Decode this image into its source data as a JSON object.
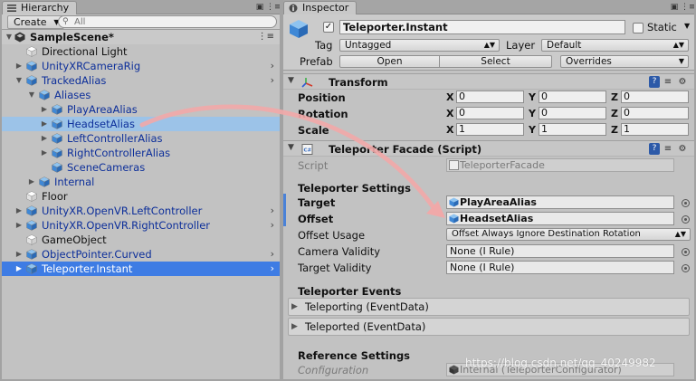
{
  "colors": {
    "selection": "#3e7ce4",
    "hover": "#9cc3e8",
    "prefab_text": "#0d2f9a",
    "annotation_arrow": "#f2a8a8",
    "panel_bg": "#c2c2c2"
  },
  "hierarchy": {
    "tab_title": "Hierarchy",
    "tab_icon": "list-icon",
    "create_label": "Create",
    "search_placeholder": "All",
    "scene_name": "SampleScene*",
    "items": [
      {
        "label": "Directional Light",
        "depth": 1,
        "prefab": false,
        "arrow": "none",
        "chevron": false
      },
      {
        "label": "UnityXRCameraRig",
        "depth": 1,
        "prefab": true,
        "arrow": "collapsed",
        "chevron": true
      },
      {
        "label": "TrackedAlias",
        "depth": 1,
        "prefab": true,
        "arrow": "expanded",
        "chevron": true
      },
      {
        "label": "Aliases",
        "depth": 2,
        "prefab": true,
        "arrow": "expanded",
        "chevron": false
      },
      {
        "label": "PlayAreaAlias",
        "depth": 3,
        "prefab": true,
        "arrow": "collapsed",
        "chevron": false
      },
      {
        "label": "HeadsetAlias",
        "depth": 3,
        "prefab": true,
        "arrow": "collapsed",
        "chevron": false,
        "hovered": true
      },
      {
        "label": "LeftControllerAlias",
        "depth": 3,
        "prefab": true,
        "arrow": "collapsed",
        "chevron": false
      },
      {
        "label": "RightControllerAlias",
        "depth": 3,
        "prefab": true,
        "arrow": "collapsed",
        "chevron": false
      },
      {
        "label": "SceneCameras",
        "depth": 3,
        "prefab": true,
        "arrow": "none",
        "chevron": false
      },
      {
        "label": "Internal",
        "depth": 2,
        "prefab": true,
        "arrow": "collapsed",
        "chevron": false
      },
      {
        "label": "Floor",
        "depth": 1,
        "prefab": false,
        "arrow": "none",
        "chevron": false
      },
      {
        "label": "UnityXR.OpenVR.LeftController",
        "depth": 1,
        "prefab": true,
        "arrow": "collapsed",
        "chevron": true
      },
      {
        "label": "UnityXR.OpenVR.RightController",
        "depth": 1,
        "prefab": true,
        "arrow": "collapsed",
        "chevron": true
      },
      {
        "label": "GameObject",
        "depth": 1,
        "prefab": false,
        "arrow": "none",
        "chevron": false
      },
      {
        "label": "ObjectPointer.Curved",
        "depth": 1,
        "prefab": true,
        "arrow": "collapsed",
        "chevron": true
      },
      {
        "label": "Teleporter.Instant",
        "depth": 1,
        "prefab": true,
        "arrow": "collapsed",
        "chevron": true,
        "selected": true
      }
    ]
  },
  "inspector": {
    "tab_title": "Inspector",
    "tab_icon": "info-icon",
    "object_name": "Teleporter.Instant",
    "active_checked": true,
    "static_label": "Static",
    "static_checked": false,
    "tag_label": "Tag",
    "tag_value": "Untagged",
    "layer_label": "Layer",
    "layer_value": "Default",
    "prefab_label": "Prefab",
    "open_label": "Open",
    "select_label": "Select",
    "overrides_label": "Overrides",
    "transform": {
      "title": "Transform",
      "rows": [
        {
          "label": "Position",
          "x": "0",
          "y": "0",
          "z": "0"
        },
        {
          "label": "Rotation",
          "x": "0",
          "y": "0",
          "z": "0"
        },
        {
          "label": "Scale",
          "x": "1",
          "y": "1",
          "z": "1"
        }
      ]
    },
    "facade": {
      "title": "Teleporter Facade (Script)",
      "script_label": "Script",
      "script_value": "TeleporterFacade",
      "settings_title": "Teleporter Settings",
      "target_label": "Target",
      "target_value": "PlayAreaAlias",
      "offset_label": "Offset",
      "offset_value": "HeadsetAlias",
      "offset_usage_label": "Offset Usage",
      "offset_usage_value": "Offset Always Ignore Destination Rotation",
      "camera_validity_label": "Camera Validity",
      "camera_validity_value": "None (I Rule)",
      "target_validity_label": "Target Validity",
      "target_validity_value": "None (I Rule)",
      "events_title": "Teleporter Events",
      "event_1": "Teleporting (EventData)",
      "event_2": "Teleported (EventData)",
      "reference_title": "Reference Settings",
      "configuration_label": "Configuration",
      "configuration_value": "Internal (TeleporterConfigurator)"
    }
  },
  "watermark": "https://blog.csdn.net/qq_40249982"
}
